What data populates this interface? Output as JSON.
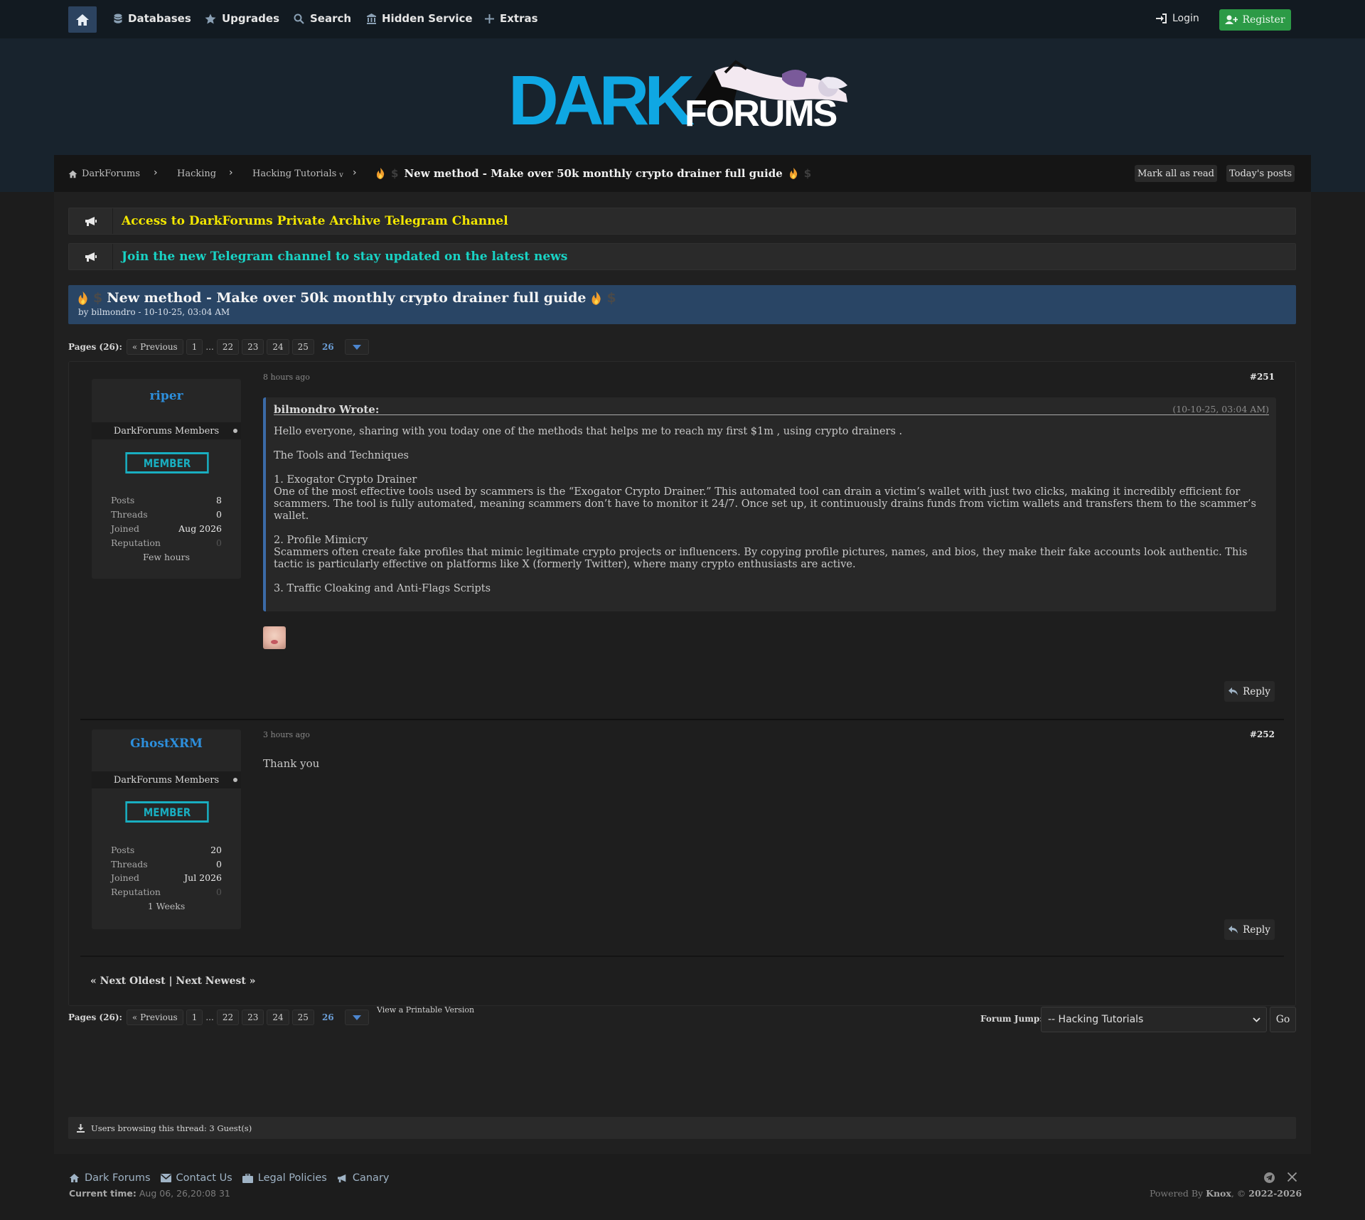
{
  "nav": {
    "items": [
      {
        "label": "Databases",
        "icon": "database-icon"
      },
      {
        "label": "Upgrades",
        "icon": "star-icon"
      },
      {
        "label": "Search",
        "icon": "search-icon"
      },
      {
        "label": "Hidden Service",
        "icon": "building-icon"
      },
      {
        "label": "Extras",
        "icon": "plus-icon"
      }
    ],
    "login": "Login",
    "register": "Register"
  },
  "logo": {
    "dark": "DARK",
    "forums": "FORUMS"
  },
  "breadcrumb": {
    "items": [
      "DarkForums",
      "Hacking",
      "Hacking Tutorials",
      "v"
    ],
    "current": "New method - Make over 50k monthly crypto drainer full guide",
    "mark_read": "Mark all as read",
    "todays_posts": "Today's posts"
  },
  "announcements": [
    {
      "text": "Access to DarkForums Private Archive Telegram Channel",
      "color": "#f2e600"
    },
    {
      "text": "Join the new Telegram channel to stay updated on the latest news",
      "color": "#19d3c5"
    }
  ],
  "thread": {
    "title": "New method - Make over 50k monthly crypto drainer full guide",
    "by": "by bilmondro - 10-10-25, 03:04 AM"
  },
  "pager": {
    "label": "Pages (26):",
    "previous": "« Previous",
    "pages": [
      "1",
      "...",
      "22",
      "23",
      "24",
      "25"
    ],
    "current": "26"
  },
  "posts": [
    {
      "username": "riper",
      "group": "DarkForums Members",
      "badge": "MEMBER",
      "stats": [
        {
          "k": "Posts",
          "v": "8"
        },
        {
          "k": "Threads",
          "v": "0"
        },
        {
          "k": "Joined",
          "v": "Aug 2026"
        },
        {
          "k": "Reputation",
          "v": "0"
        }
      ],
      "activity": "Few hours",
      "time": "8 hours ago",
      "number": "#251",
      "quote": {
        "author": "bilmondro Wrote:",
        "date": "(10-10-25, 03:04 AM)",
        "paragraphs": [
          "Hello everyone, sharing with you today one of the methods that helps me to reach my first $1m , using crypto drainers .\n ",
          "The Tools and Techniques",
          "1. Exogator Crypto Drainer\nOne of the most effective tools used by scammers is the “Exogator Crypto Drainer.” This automated tool can drain a victim’s wallet with just two clicks, making it incredibly efficient for scammers. The tool is fully automated, meaning scammers don’t have to monitor it 24/7. Once set up, it continuously drains funds from victim wallets and transfers them to the scammer’s wallet.",
          "2. Profile Mimicry\nScammers often create fake profiles that mimic legitimate crypto projects or influencers. By copying profile pictures, names, and bios, they make their fake accounts look authentic. This tactic is particularly effective on platforms like X (formerly Twitter), where many crypto enthusiasts are active.",
          "3. Traffic Cloaking and Anti-Flags Scripts"
        ]
      },
      "reply": "Reply"
    },
    {
      "username": "GhostXRM",
      "group": "DarkForums Members",
      "badge": "MEMBER",
      "stats": [
        {
          "k": "Posts",
          "v": "20"
        },
        {
          "k": "Threads",
          "v": "0"
        },
        {
          "k": "Joined",
          "v": "Jul 2026"
        },
        {
          "k": "Reputation",
          "v": "0"
        }
      ],
      "activity": "1 Weeks",
      "time": "3 hours ago",
      "number": "#252",
      "text": "Thank you",
      "reply": "Reply"
    }
  ],
  "next_links": "« Next Oldest | Next Newest »",
  "printable": "View a Printable Version",
  "forum_jump": {
    "label": "Forum Jump:",
    "value": "-- Hacking Tutorials",
    "go": "Go"
  },
  "browsing": "Users browsing this thread: 3 Guest(s)",
  "footer": {
    "links": [
      "Dark Forums",
      "Contact Us",
      "Legal Policies",
      "Canary"
    ],
    "current_time_label": "Current time:",
    "current_time": "Aug 06, 26,20:08 31",
    "powered_prefix": "Powered By",
    "powered_name": "Knox",
    "powered_suffix": ", ©",
    "powered_years": "2022-2026"
  },
  "colors": {
    "accent": "#294565",
    "brand": "#0fa7e3",
    "register": "#2c9a46",
    "username": "#2d8fdc",
    "badge": "#19aec0"
  }
}
